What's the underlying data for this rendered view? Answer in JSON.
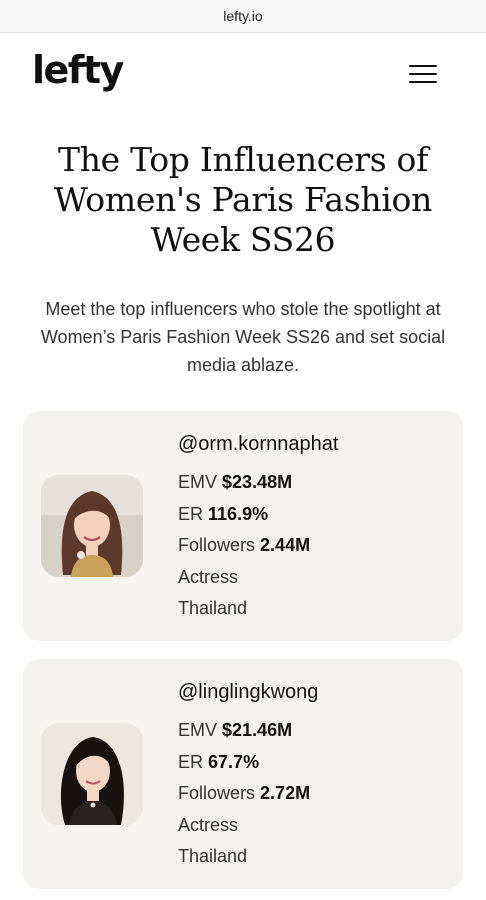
{
  "browser": {
    "url": "lefty.io"
  },
  "header": {
    "logo": "lefty"
  },
  "page": {
    "title": "The Top Influencers of Women's Paris Fashion Week SS26",
    "subtitle": "Meet the top influencers who stole the spotlight at Women’s Paris Fashion Week SS26 and set social media ablaze."
  },
  "influencers": [
    {
      "handle": "@orm.kornnaphat",
      "emv_label": "EMV",
      "emv": "$23.48M",
      "er_label": "ER",
      "er": "116.9%",
      "followers_label": "Followers",
      "followers": "2.44M",
      "profession": "Actress",
      "country": "Thailand"
    },
    {
      "handle": "@linglingkwong",
      "emv_label": "EMV",
      "emv": "$21.46M",
      "er_label": "ER",
      "er": "67.7%",
      "followers_label": "Followers",
      "followers": "2.72M",
      "profession": "Actress",
      "country": "Thailand"
    }
  ],
  "colors": {
    "card_background": "#f5f3f0",
    "text_primary": "#111111",
    "text_secondary": "#333333"
  }
}
